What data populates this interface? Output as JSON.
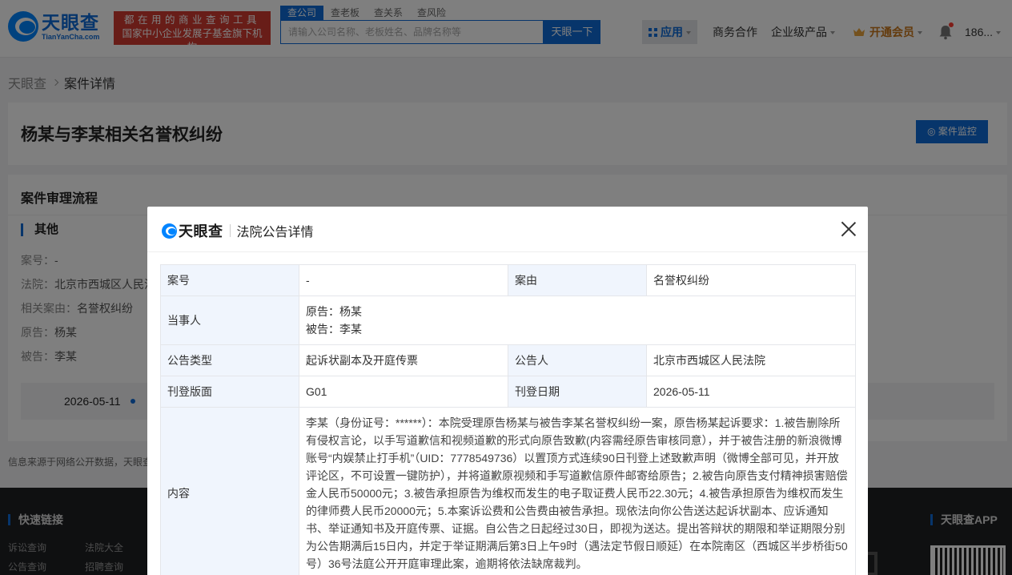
{
  "header": {
    "logo_cn": "天眼查",
    "logo_en": "TianYanCha.com",
    "slogan_line1": "都在用的商业查询工具",
    "slogan_line2": "国家中小企业发展子基金旗下机构",
    "search_tabs": [
      "查公司",
      "查老板",
      "查关系",
      "查风险"
    ],
    "search_placeholder": "请输入公司名称、老板姓名、品牌名称等",
    "search_button": "天眼一下",
    "nav": {
      "apps": "应用",
      "business": "商务合作",
      "enterprise": "企业级产品",
      "vip": "开通会员",
      "user": "186..."
    }
  },
  "breadcrumb": [
    "天眼查",
    "案件详情"
  ],
  "case": {
    "title": "杨某与李某相关名誉权纠纷",
    "monitor_button": "案件监控"
  },
  "process": {
    "section_title": "案件审理流程",
    "sub_title": "其他",
    "fields": [
      {
        "label": "案号：",
        "value": "-"
      },
      {
        "label": "法院：",
        "value": "北京市西城区人民法"
      },
      {
        "label": "相关案由：",
        "value": "名誉权纠纷"
      },
      {
        "label": "原告：",
        "value": "杨某"
      },
      {
        "label": "被告：",
        "value": "李某"
      }
    ],
    "timeline_date": "2026-05-11"
  },
  "source_note": "信息来源于网络公开数据，天眼查",
  "footer": {
    "quick_links_title": "快速链接",
    "links": [
      "诉讼查询",
      "法院大全",
      "公告查询",
      "招聘查询"
    ],
    "app_title": "天眼查APP"
  },
  "modal": {
    "logo": "天眼查",
    "title": "法院公告详情",
    "rows": {
      "case_no_label": "案号",
      "case_no": "-",
      "cause_label": "案由",
      "cause": "名誉权纠纷",
      "party_label": "当事人",
      "plaintiff": "原告：杨某",
      "defendant": "被告：李某",
      "type_label": "公告类型",
      "type": "起诉状副本及开庭传票",
      "announcer_label": "公告人",
      "announcer": "北京市西城区人民法院",
      "page_label": "刊登版面",
      "page": "G01",
      "date_label": "刊登日期",
      "date": "2026-05-11",
      "content_label": "内容",
      "content": "李某（身份证号：******）：本院受理原告杨某与被告李某名誉权纠纷一案，原告杨某起诉要求：1.被告删除所有侵权言论，以手写道歉信和视频道歉的形式向原告致歉(内容需经原告审核同意），并于被告注册的新浪微博账号“内娱禁止打手机”（UID：7778549736）以置顶方式连续90日刊登上述致歉声明（微博全部可见，并开放评论区，不可设置一键防护），并将道歉原视频和手写道歉信原件邮寄给原告；2.被告向原告支付精神损害赔偿金人民币50000元；3.被告承担原告为维权而发生的电子取证费人民币22.30元；4.被告承担原告为维权而发生的律师费人民币20000元；5.本案诉讼费和公告费由被告承担。现依法向你公告送达起诉状副本、应诉通知书、举证通知书及开庭传票、证据。自公告之日起经过30日，即视为送达。提出答辩状的期限和举证期限分别为公告期满后15日内，并定于举证期满后第3日上午9时（遇法定节假日顺延）在本院南区（西城区半步桥街50号）36号法庭公开开庭审理此案，逾期将依法缺席裁判。"
    }
  }
}
